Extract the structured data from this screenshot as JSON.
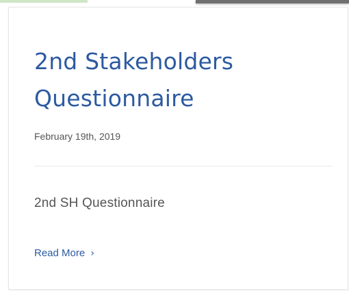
{
  "post": {
    "title": "2nd Stakeholders Questionnaire",
    "date": "February 19th, 2019",
    "excerpt": "2nd SH Questionnaire",
    "read_more_label": "Read More",
    "read_more_icon": "chevron-right-icon",
    "read_more_glyph": "›"
  },
  "colors": {
    "accent": "#2c5aa0",
    "body_text": "#555555",
    "divider": "#e9e9e9"
  }
}
